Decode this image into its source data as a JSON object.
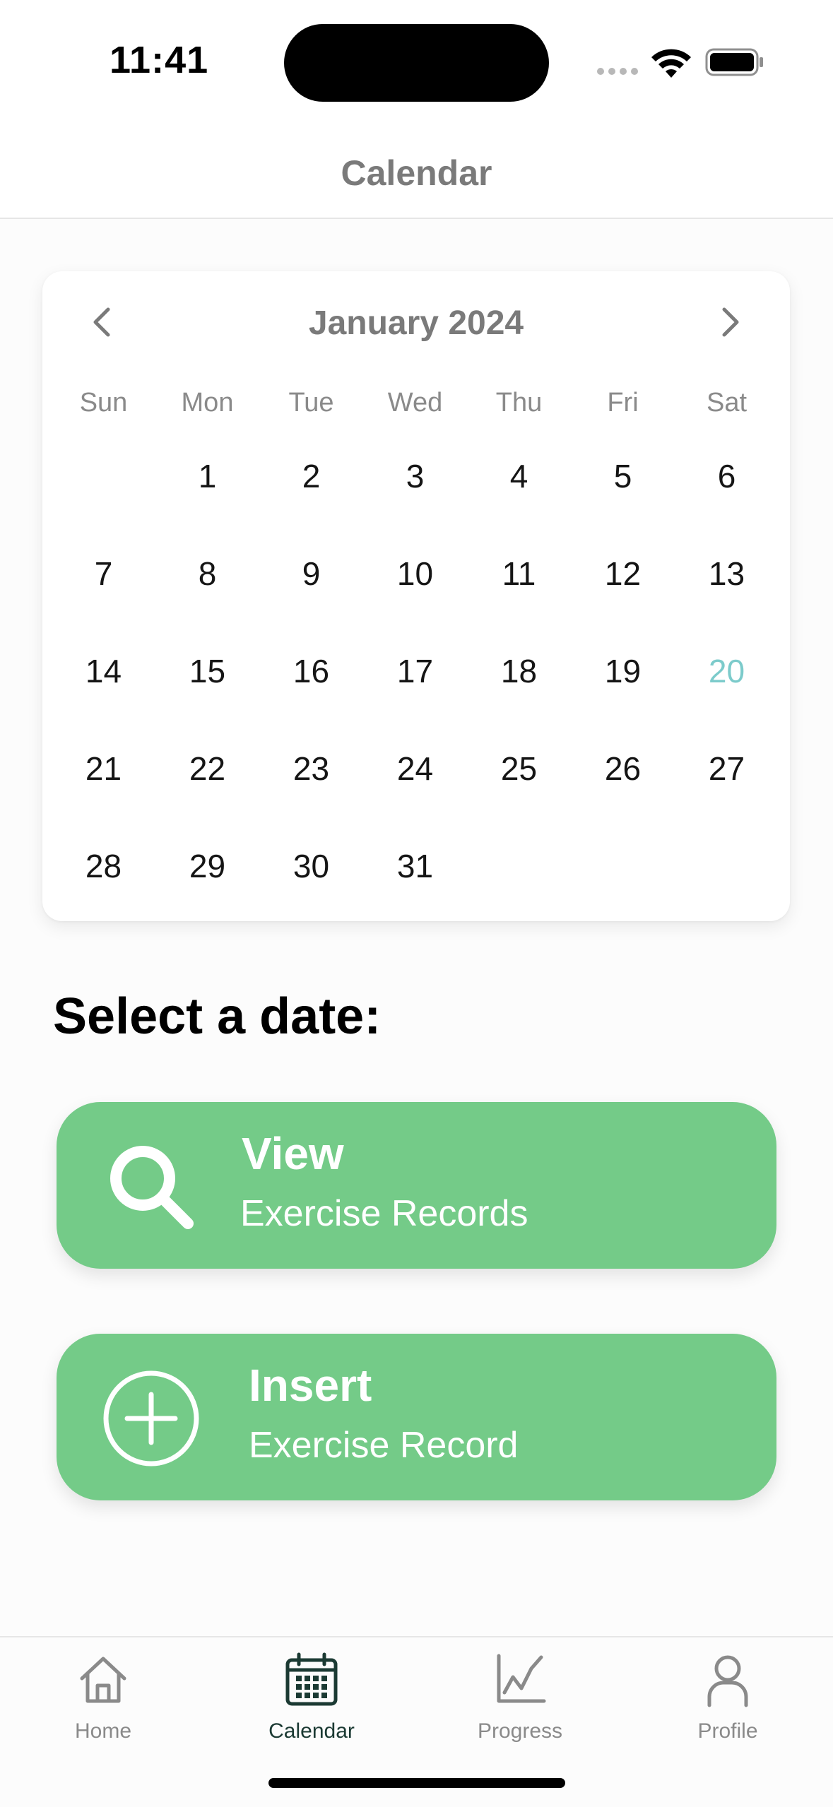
{
  "status_bar": {
    "time": "11:41"
  },
  "header": {
    "title": "Calendar"
  },
  "calendar": {
    "month_label": "January 2024",
    "weekdays": [
      "Sun",
      "Mon",
      "Tue",
      "Wed",
      "Thu",
      "Fri",
      "Sat"
    ],
    "first_weekday_index": 1,
    "days": [
      "1",
      "2",
      "3",
      "4",
      "5",
      "6",
      "7",
      "8",
      "9",
      "10",
      "11",
      "12",
      "13",
      "14",
      "15",
      "16",
      "17",
      "18",
      "19",
      "20",
      "21",
      "22",
      "23",
      "24",
      "25",
      "26",
      "27",
      "28",
      "29",
      "30",
      "31"
    ],
    "highlighted_day": "20",
    "highlight_color": "#7ccbcb"
  },
  "select_section": {
    "heading": "Select a date:"
  },
  "actions": {
    "view": {
      "title": "View",
      "subtitle": "Exercise Records",
      "icon": "search-icon"
    },
    "insert": {
      "title": "Insert",
      "subtitle": "Exercise Record",
      "icon": "plus-circle-icon"
    },
    "button_color": "#74cb88"
  },
  "tab_bar": {
    "items": [
      {
        "label": "Home",
        "icon": "home-icon"
      },
      {
        "label": "Calendar",
        "icon": "calendar-icon",
        "active": true
      },
      {
        "label": "Progress",
        "icon": "chart-icon"
      },
      {
        "label": "Profile",
        "icon": "person-icon"
      }
    ],
    "active_color": "#1b3a33",
    "inactive_color": "#8a8a8a"
  }
}
